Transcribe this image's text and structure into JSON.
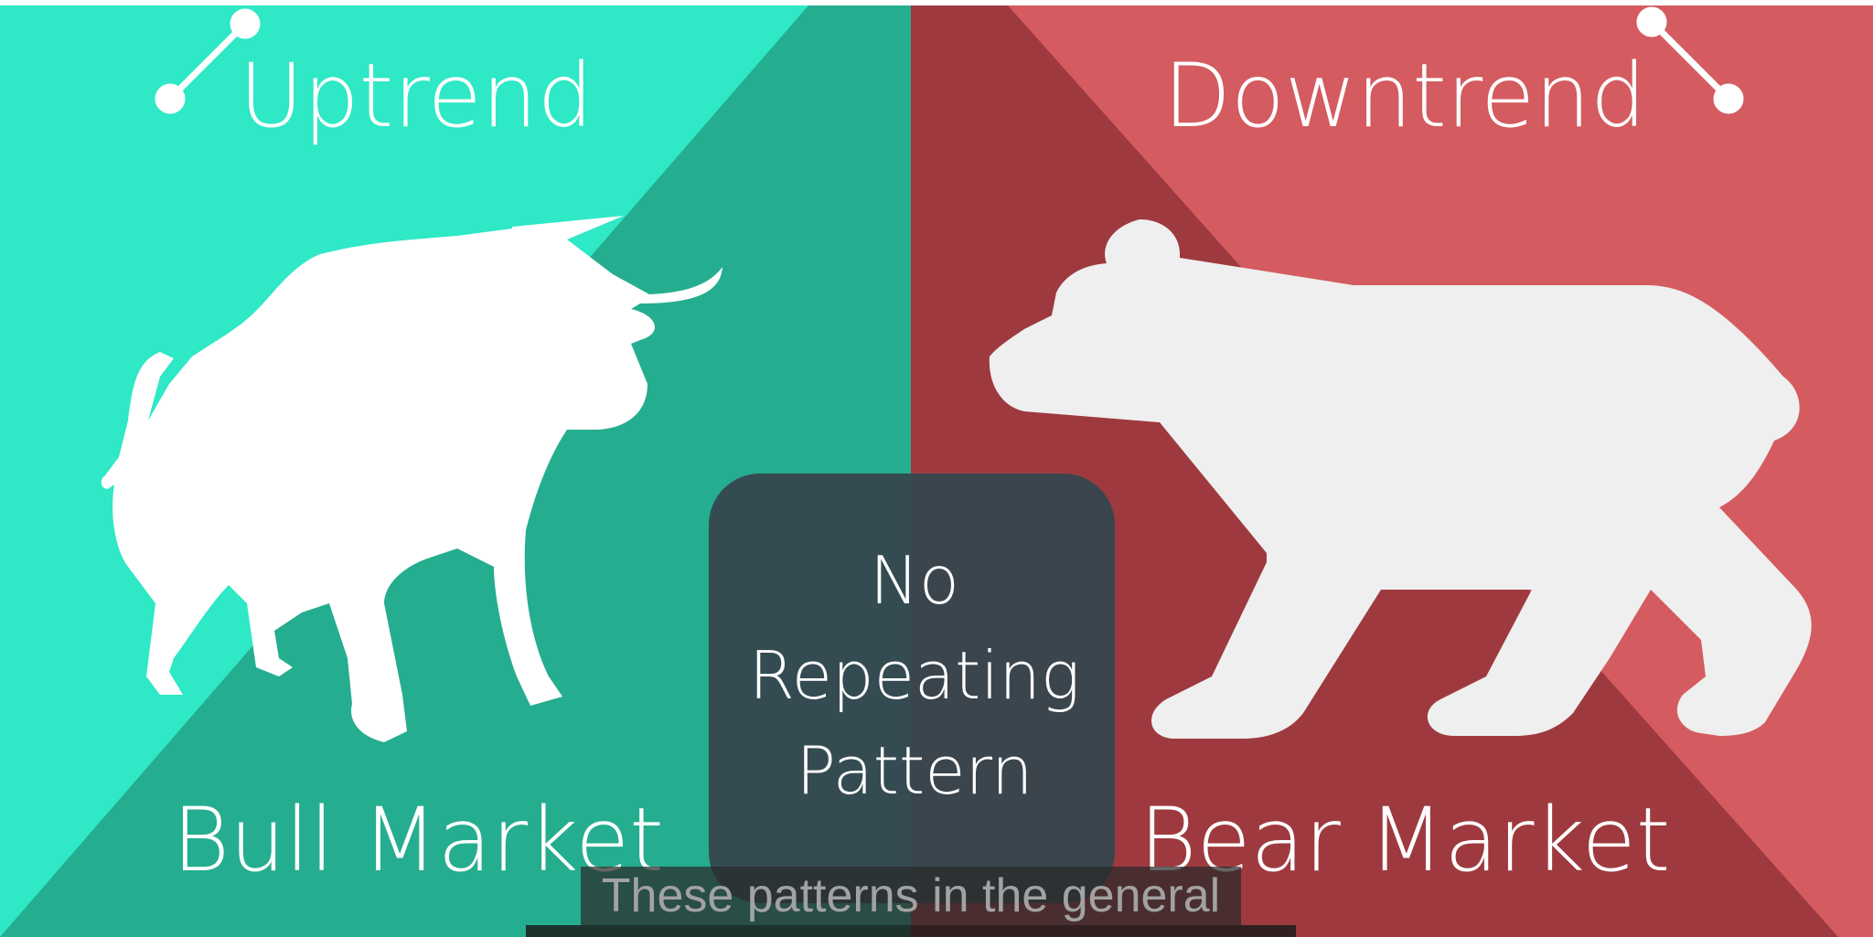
{
  "colors": {
    "bull_light": "#2ee8c6",
    "bull_dark": "#25ad8f",
    "bear_light": "#d45b5f",
    "bear_dark": "#9e3a3f",
    "center_box": "#36464f",
    "silhouette_bull": "#ffffff",
    "silhouette_bear": "#efefef",
    "caption_bg": "#2a2a2a",
    "caption_text": "#9a9a9a"
  },
  "left": {
    "heading": "Uptrend",
    "label": "Bull Market",
    "icon": "trend-up-icon",
    "animal": "bull-silhouette-icon"
  },
  "right": {
    "heading": "Downtrend",
    "label": "Bear Market",
    "icon": "trend-down-icon",
    "animal": "bear-silhouette-icon"
  },
  "center": {
    "line1": "No",
    "line2": "Repeating",
    "line3": "Pattern"
  },
  "caption": {
    "line1": "These patterns in the general"
  }
}
